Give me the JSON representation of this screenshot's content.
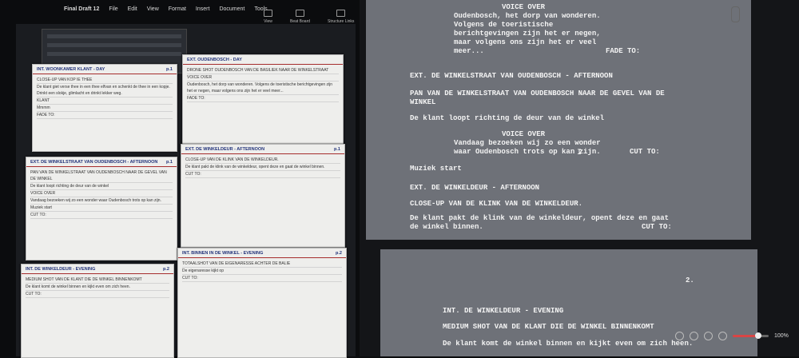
{
  "menubar": {
    "app_name": "Final Draft 12",
    "items": [
      "File",
      "Edit",
      "View",
      "Format",
      "Insert",
      "Document",
      "Tools"
    ]
  },
  "toolbar": {
    "items": [
      "View",
      "Beat Board",
      "Structure Links"
    ]
  },
  "index_cards": [
    {
      "slug": "INT. WOONKAMER KLANT - DAY",
      "page": "p.1",
      "lines": [
        "CLOSE-UP VAN KOP IE THEE",
        "De klant giet verse thee in een thee elfvan en schenkt de thee in een kopje. Drinkt een slokje, glimlacht en drinkt lekker weg.",
        "KLANT",
        "Mmmm",
        "FADE TO:"
      ]
    },
    {
      "slug": "EXT. OUDENBOSCH - DAY",
      "page": "",
      "lines": [
        "DRONE SHOT OUDENBOSCH VAN DE BASILIEK NAAR DE WINKELSTRAAT",
        "VOICE OVER",
        "Oudenbosch, het dorp van wonderen. Volgens de toeristische berichtgevingen zijn het er negen, maar volgens ons zijn het er veel meer...",
        "FADE TO:"
      ]
    },
    {
      "slug": "EXT. DE WINKELSTRAAT VAN OUDENBOSCH - AFTERNOON",
      "page": "p.1",
      "lines": [
        "PAN VAN DE WINKELSTRAAT VAN OUDENBOSCH NAAR DE GEVEL VAN DE WINKEL",
        "De klant loopt richting de deur van de winkel",
        "VOICE OVER",
        "Vandaag bezoeken wij zo een wonder waar Oudenbosch trots op kan zijn.",
        "Muziek start",
        "CUT TO:"
      ]
    },
    {
      "slug": "EXT. DE WINKELDEUR - AFTERNOON",
      "page": "p.1",
      "lines": [
        "CLOSE-UP VAN DE KLINK VAN DE WINKELDEUR.",
        "De klant pakt de klink van de winkeldeur, opent deze en gaat de winkel binnen.",
        "CUT TO:"
      ]
    },
    {
      "slug": "INT. DE WINKELDEUR - EVENING",
      "page": "p.2",
      "lines": [
        "MEDIUM SHOT VAN DE KLANT DIE DE WINKEL BINNENKOMT",
        "De klant komt de winkel binnen en kijkt even om zich heen.",
        "CUT TO:"
      ]
    },
    {
      "slug": "INT. BINNEN IN DE WINKEL - EVENING",
      "page": "p.2",
      "lines": [
        "TOTAALSHOT VAN DE EIGENARESSE ACHTER DE BALIE",
        "De eigenaresse kijkt op",
        "CUT TO:"
      ]
    }
  ],
  "script_page1": [
    "VOICE OVER",
    "Oudenbosch, het dorp van wonderen.",
    "Volgens de toeristische",
    "berichtgevingen zijn het er negen,",
    "maar volgens ons zijn het er veel",
    "meer...",
    "FADE TO:",
    "EXT. DE WINKELSTRAAT VAN OUDENBOSCH - AFTERNOON",
    "PAN VAN DE WINKELSTRAAT VAN OUDENBOSCH NAAR DE GEVEL VAN DE",
    "WINKEL",
    "De klant loopt richting de deur van de winkel",
    "VOICE OVER",
    "Vandaag bezoeken wij zo een wonder",
    "waar Oudenbosch trots op kan zijn.",
    "CUT TO:",
    "Muziek start",
    "EXT. DE WINKELDEUR - AFTERNOON",
    "CLOSE-UP VAN DE KLINK VAN DE WINKELDEUR.",
    "De klant pakt de klink van de winkeldeur, opent deze en gaat",
    "de winkel binnen.",
    "CUT TO:"
  ],
  "script_page2": {
    "page_number": "2.",
    "lines": [
      "INT. DE WINKELDEUR - EVENING",
      "MEDIUM SHOT VAN DE KLANT DIE DE WINKEL BINNENKOMT",
      "De klant komt de winkel binnen en kijkt even om zich heen."
    ]
  },
  "zoom": {
    "label": "100%",
    "value": 0.7
  },
  "colors": {
    "accent": "#d94545",
    "slug": "#22337a",
    "page": "#6e7178"
  }
}
